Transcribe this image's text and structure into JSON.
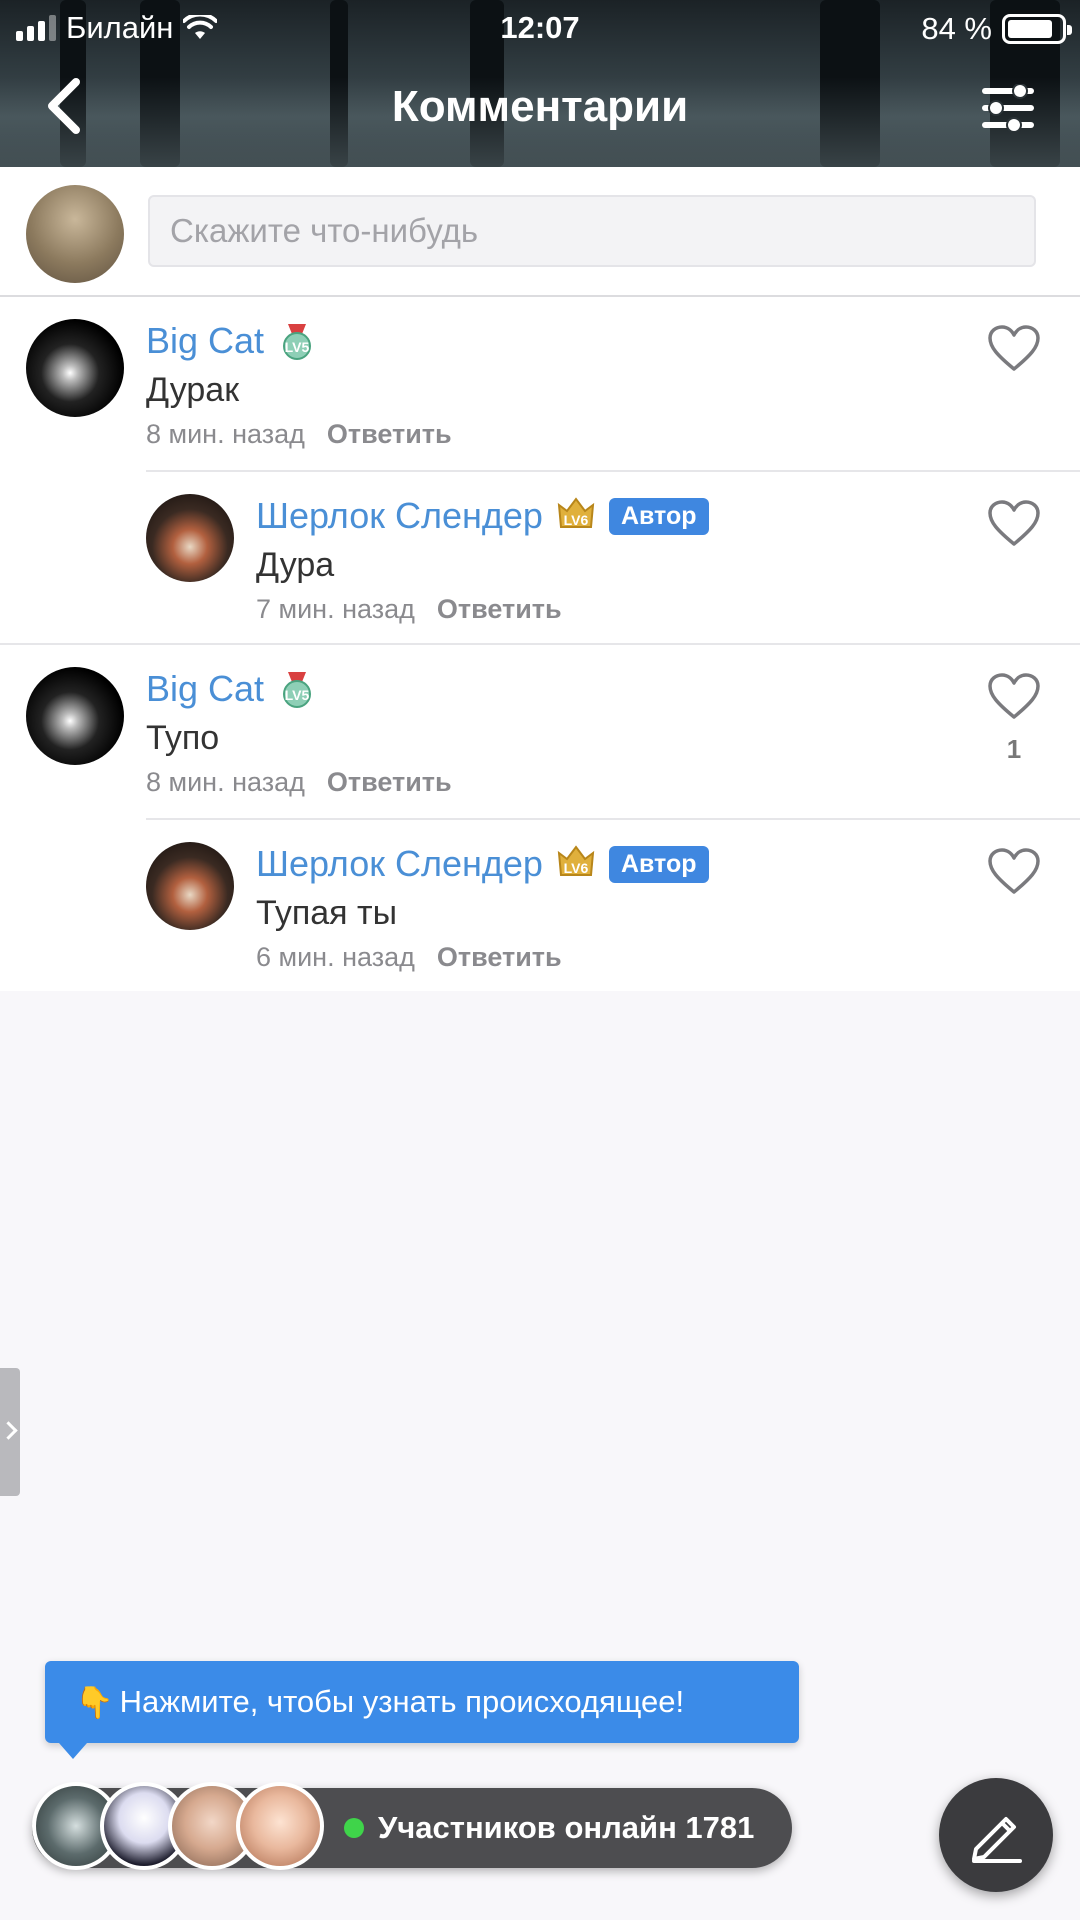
{
  "status_bar": {
    "carrier": "Билайн",
    "time": "12:07",
    "battery": "84 %",
    "battery_level": 0.84
  },
  "header": {
    "title": "Комментарии"
  },
  "input": {
    "placeholder": "Скажите что-нибудь"
  },
  "comments": [
    {
      "username": "Big Cat",
      "level": "LV5",
      "text": "Дурак",
      "time": "8 мин. назад",
      "reply_label": "Ответить",
      "likes": "",
      "replies": [
        {
          "username": "Шерлок Слендер",
          "level": "LV6",
          "author_badge": "Автор",
          "text": "Дура",
          "time": "7 мин. назад",
          "reply_label": "Ответить",
          "likes": ""
        }
      ]
    },
    {
      "username": "Big Cat",
      "level": "LV5",
      "text": "Тупо",
      "time": "8 мин. назад",
      "reply_label": "Ответить",
      "likes": "1",
      "replies": [
        {
          "username": "Шерлок Слендер",
          "level": "LV6",
          "author_badge": "Автор",
          "text": "Тупая ты",
          "time": "6 мин. назад",
          "reply_label": "Ответить",
          "likes": ""
        }
      ]
    }
  ],
  "tooltip": {
    "emoji": "👇",
    "text": "Нажмите, чтобы узнать происходящее!"
  },
  "online": {
    "label": "Участников онлайн 1781"
  },
  "colors": {
    "accent": "#3b8be8",
    "username": "#4a8fd6",
    "online_dot": "#3fd44a"
  },
  "icons": [
    "back-icon",
    "filter-icon",
    "heart-icon",
    "lv-badge-icon",
    "edit-icon"
  ]
}
